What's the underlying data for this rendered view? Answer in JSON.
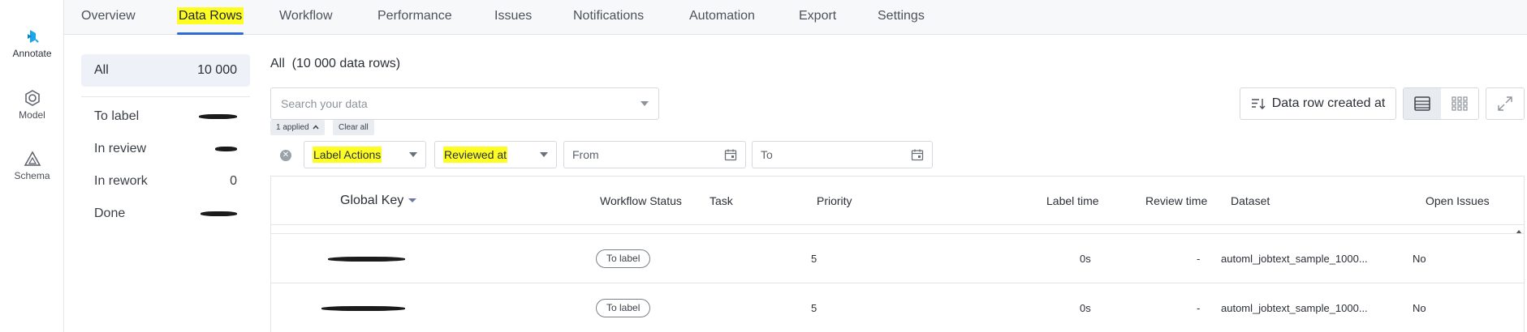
{
  "rail": {
    "items": [
      {
        "label": "Annotate",
        "icon": "annotate-icon"
      },
      {
        "label": "Model",
        "icon": "model-icon"
      },
      {
        "label": "Schema",
        "icon": "schema-icon"
      }
    ]
  },
  "tabs": [
    {
      "label": "Overview"
    },
    {
      "label": "Data Rows"
    },
    {
      "label": "Workflow"
    },
    {
      "label": "Performance"
    },
    {
      "label": "Issues"
    },
    {
      "label": "Notifications"
    },
    {
      "label": "Automation"
    },
    {
      "label": "Export"
    },
    {
      "label": "Settings"
    }
  ],
  "panel": {
    "all": {
      "label": "All",
      "count": "10 000"
    },
    "rows": [
      {
        "label": "To label"
      },
      {
        "label": "In review"
      },
      {
        "label": "In rework",
        "count": "0"
      },
      {
        "label": "Done"
      }
    ]
  },
  "main": {
    "title": "All  (10 000 data rows)",
    "search_placeholder": "Search your data",
    "applied_chip": "1 applied",
    "clear_chip": "Clear all",
    "filters": {
      "label_actions": "Label Actions",
      "reviewed_at": "Reviewed at",
      "from": "From",
      "to": "To"
    },
    "sort_label": "Data row created at"
  },
  "table": {
    "headers": {
      "global_key": "Global Key",
      "workflow_status": "Workflow Status",
      "task": "Task",
      "priority": "Priority",
      "label_time": "Label time",
      "review_time": "Review time",
      "dataset": "Dataset",
      "open_issues": "Open Issues"
    },
    "rows": [
      {
        "status": "To label",
        "priority": "5",
        "label_time": "0s",
        "review_time": "-",
        "dataset": "automl_jobtext_sample_1000...",
        "open_issues": "No"
      },
      {
        "status": "To label",
        "priority": "5",
        "label_time": "0s",
        "review_time": "-",
        "dataset": "automl_jobtext_sample_1000...",
        "open_issues": "No"
      }
    ]
  },
  "colors": {
    "highlight": "#fdfd24",
    "tab_underline": "#2f6bd8",
    "brand_cyan": "#1aa6e8"
  }
}
